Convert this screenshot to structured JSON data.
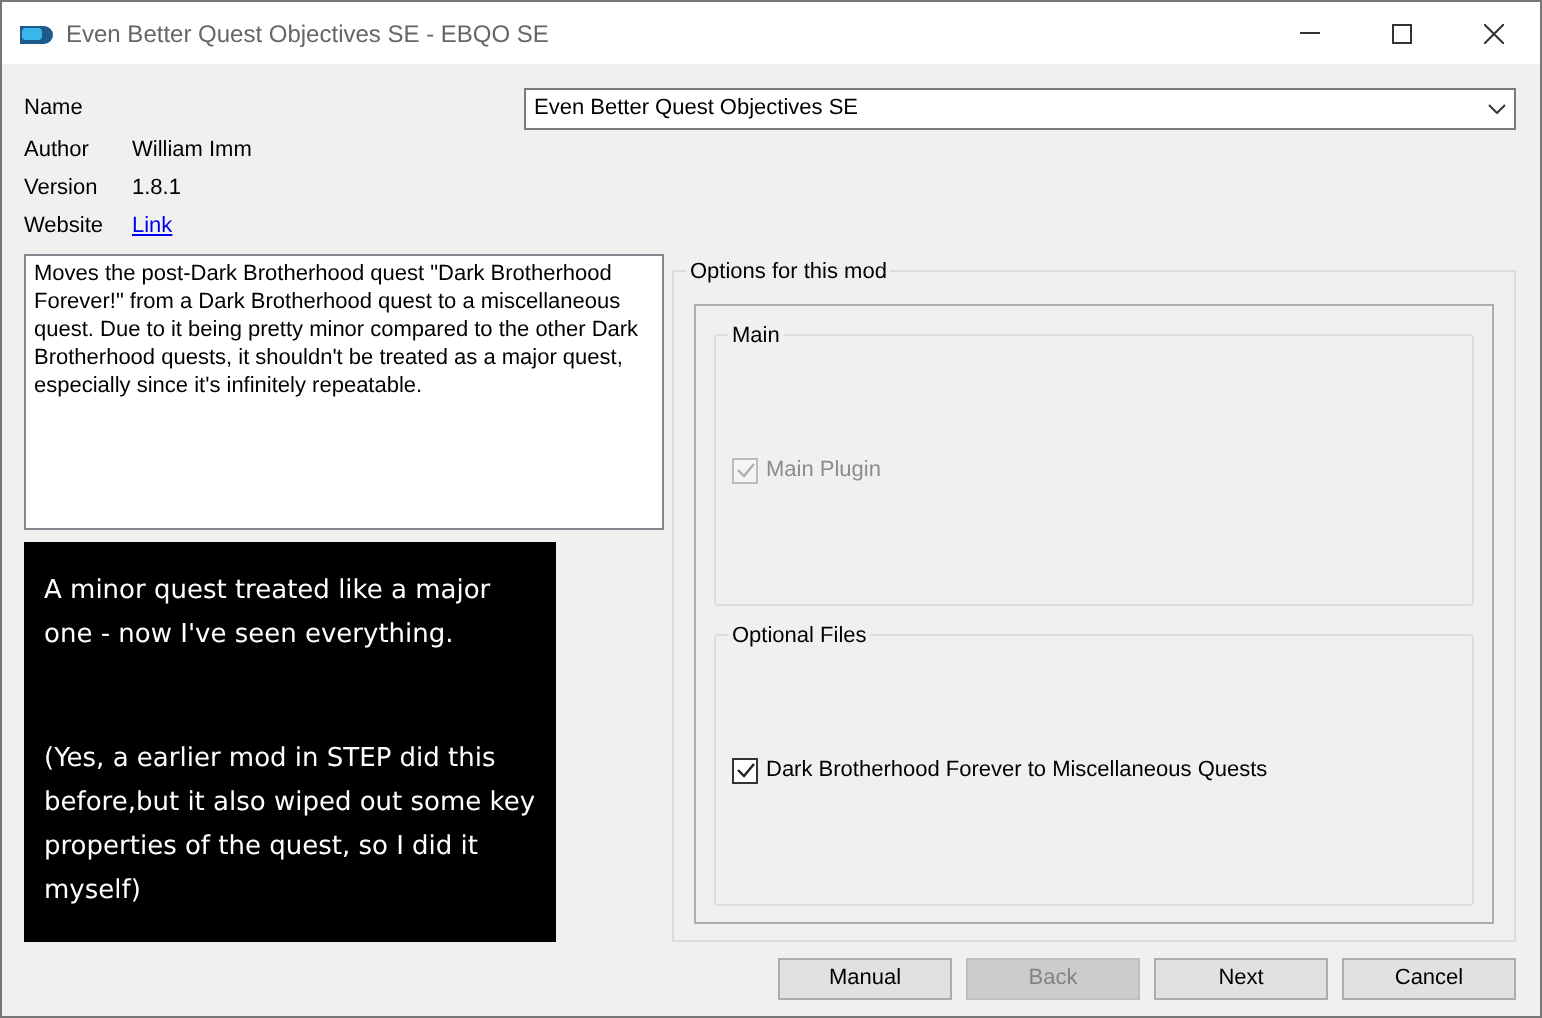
{
  "window": {
    "title": "Even Better Quest Objectives SE - EBQO SE"
  },
  "info": [
    {
      "label": "Name",
      "kind": "select",
      "value": "Even Better Quest Objectives SE"
    },
    {
      "label": "Author",
      "kind": "text",
      "value": "William Imm"
    },
    {
      "label": "Version",
      "kind": "text",
      "value": "1.8.1"
    },
    {
      "label": "Website",
      "kind": "link",
      "value": "Link"
    }
  ],
  "description": "Moves the post-Dark Brotherhood quest \"Dark Brotherhood Forever!\" from a Dark Brotherhood quest to a miscellaneous quest. Due to it being pretty minor compared to the other Dark Brotherhood quests, it shouldn't be treated as a major quest, especially since it's infinitely repeatable.",
  "image_text": [
    "A minor quest  treated like a major one - now I've seen everything.",
    "(Yes, a earlier mod in STEP did this before,but it also wiped out some key properties of the quest, so I did it myself)"
  ],
  "options": {
    "title": "Options for this mod",
    "groups": [
      {
        "title": "Main",
        "items": [
          {
            "label": "Main Plugin",
            "checked": true,
            "disabled": true
          }
        ]
      },
      {
        "title": "Optional Files",
        "items": [
          {
            "label": "Dark Brotherhood Forever to Miscellaneous Quests",
            "checked": true,
            "disabled": false
          }
        ]
      }
    ]
  },
  "buttons": [
    {
      "label": "Manual",
      "disabled": false
    },
    {
      "label": "Back",
      "disabled": true
    },
    {
      "label": "Next",
      "disabled": false
    },
    {
      "label": "Cancel",
      "disabled": false
    }
  ]
}
